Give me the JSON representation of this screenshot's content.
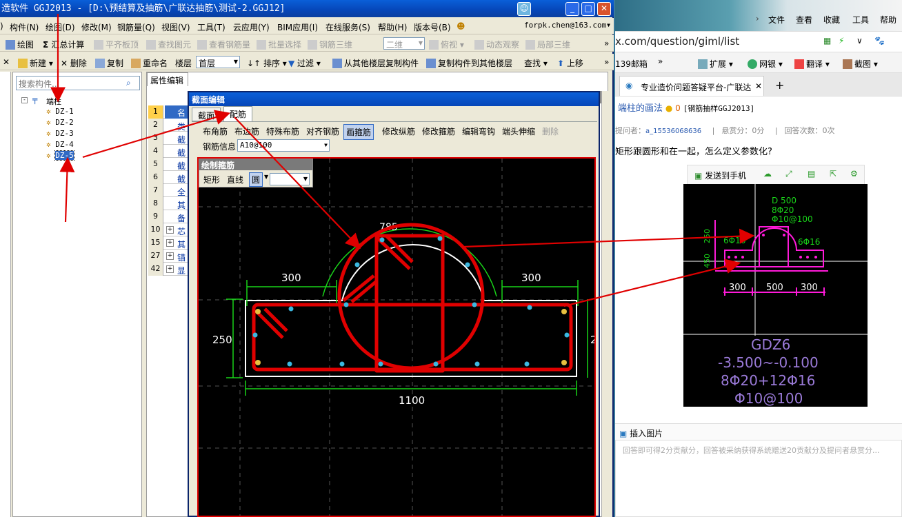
{
  "app": {
    "title": "造软件 GGJ2013 - [D:\\预结算及抽筋\\广联达抽筋\\测试-2.GGJ12]",
    "menu": [
      "构件(N)",
      "绘图(D)",
      "修改(M)",
      "钢筋量(Q)",
      "视图(V)",
      "工具(T)",
      "云应用(Y)",
      "BIM应用(I)",
      "在线服务(S)",
      "帮助(H)",
      "版本号(B)"
    ],
    "user_email": "forpk.chen@163.com",
    "toolbar1": {
      "draw": "绘图",
      "sum": "汇总计算",
      "flat": "平齐板顶",
      "find": "查找图元",
      "view_rebar": "查看钢筋量",
      "batch": "批量选择",
      "rebar3d": "钢筋三维",
      "mode": "二维",
      "top": "俯视",
      "dynamic": "动态观察",
      "local3d": "局部三维"
    },
    "toolbar2": {
      "new": "新建",
      "delete": "删除",
      "copy": "复制",
      "rename": "重命名",
      "floor_label": "楼层",
      "floor_value": "首层",
      "sort": "排序",
      "filter": "过滤",
      "copy_from": "从其他楼层复制构件",
      "copy_to": "复制构件到其他楼层",
      "find": "查找",
      "up": "上移"
    },
    "search_placeholder": "搜索构件...",
    "tree": {
      "root": "端柱",
      "items": [
        "DZ-1",
        "DZ-2",
        "DZ-3",
        "DZ-4",
        "DZ-5"
      ]
    },
    "props_tab": "属性编辑",
    "props_rows": [
      {
        "num": "1",
        "text": "名"
      },
      {
        "num": "2",
        "text": "类"
      },
      {
        "num": "3",
        "text": "截"
      },
      {
        "num": "4",
        "text": "截"
      },
      {
        "num": "5",
        "text": "截"
      },
      {
        "num": "6",
        "text": "截"
      },
      {
        "num": "7",
        "text": "全"
      },
      {
        "num": "8",
        "text": "其"
      },
      {
        "num": "9",
        "text": "备"
      },
      {
        "num": "10",
        "text": "芯"
      },
      {
        "num": "15",
        "text": "其"
      },
      {
        "num": "27",
        "text": "锚"
      },
      {
        "num": "42",
        "text": "显"
      }
    ]
  },
  "dialog": {
    "title": "截面编辑",
    "tabs": [
      "截面",
      "配筋"
    ],
    "tools": [
      "布角筋",
      "布边筋",
      "特殊布筋",
      "对齐钢筋",
      "画箍筋",
      "修改纵筋",
      "修改箍筋",
      "编辑弯钩",
      "端头伸缩",
      "删除"
    ],
    "rebar_info_label": "钢筋信息",
    "rebar_info_value": "A10@100",
    "draw_panel": {
      "title": "绘制箍筋",
      "rect": "矩形",
      "line": "直线",
      "circle": "圆"
    },
    "dims": {
      "arc": "785",
      "left": "300",
      "right": "300",
      "height": "250",
      "height_cut": "2",
      "total": "1100"
    }
  },
  "browser": {
    "menu": [
      "文件",
      "查看",
      "收藏",
      "工具",
      "帮助"
    ],
    "url": "x.com/question/giml/list",
    "bookmarks": [
      "139邮箱",
      "扩展",
      "网银",
      "翻译",
      "截图"
    ],
    "tab_title": "专业造价问题答疑平台-广联达",
    "question_title": "端柱的画法",
    "coins": "0",
    "tag": "[钢筋抽样GGJ2013]",
    "asker_label": "提问者：",
    "asker": "a_15536068636",
    "reward": "悬赏分：0分",
    "answers": "回答次数：0次",
    "question": "矩形跟圆形和在一起，怎么定义参数化?",
    "send_phone": "发送到手机",
    "insert_image": "插入图片",
    "answer_placeholder": "回答即可得2分贡献分，回答被采纳获得系统赠送20贡献分及提问者悬赏分...",
    "drawing": {
      "d": "D 500",
      "r1": "8Φ20",
      "r2": "Φ10@100",
      "left": "6Φ16",
      "right": "6Φ16",
      "v1": "250",
      "v2": "450",
      "b1": "300",
      "b2": "500",
      "b3": "300",
      "code": "GDZ6",
      "elev": "-3.500~-0.100",
      "main": "8Φ20+12Φ16",
      "stir": "Φ10@100"
    }
  },
  "colors": {
    "red": "#e00000",
    "green": "#19d419",
    "magenta": "#ff1ad9"
  }
}
